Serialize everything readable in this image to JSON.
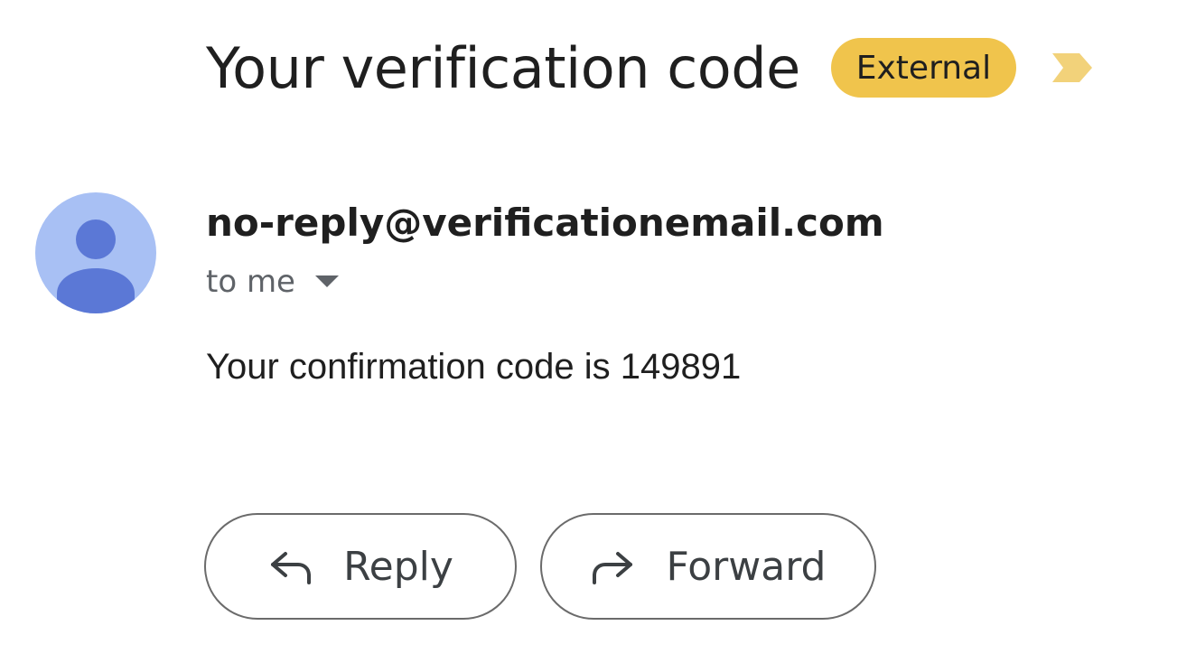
{
  "email": {
    "subject": "Your verification code",
    "label_badge": "External",
    "important_marker_icon": "importance-marker-icon",
    "sender": {
      "avatar_icon": "person-icon",
      "address": "no-reply@verificationemail.com",
      "recipient_text": "to me",
      "details_icon": "chevron-down-icon"
    },
    "body": "Your confirmation code is 149891"
  },
  "actions": {
    "reply_label": "Reply",
    "reply_icon": "reply-arrow-icon",
    "forward_label": "Forward",
    "forward_icon": "forward-arrow-icon"
  },
  "colors": {
    "badge_background": "#f0c44c",
    "important_marker": "#f2d27a",
    "avatar_background": "#a8c0f4",
    "avatar_figure": "#5b78d6",
    "text_primary": "#1f1f1f",
    "text_secondary": "#5f6368",
    "button_border": "#6b6b6b"
  }
}
